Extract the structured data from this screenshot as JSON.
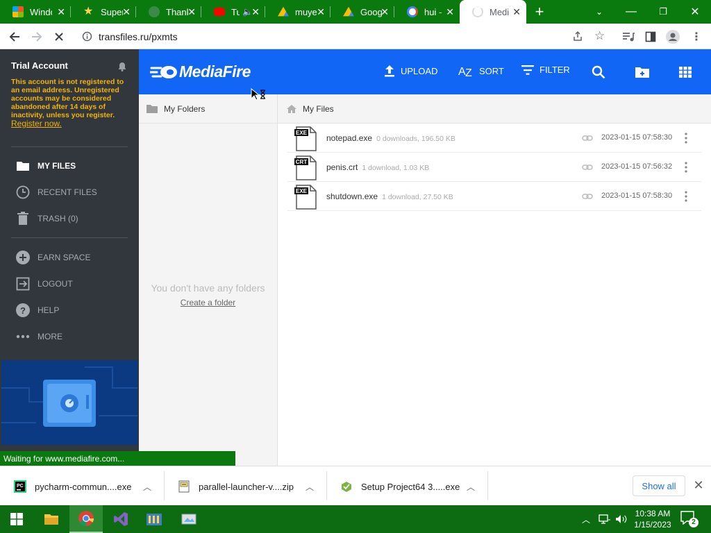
{
  "browser": {
    "tabs": [
      {
        "title": "Windows",
        "icon": "windows-logo-icon",
        "favicon_color": "#f35325"
      },
      {
        "title": "Super",
        "icon": "star-icon",
        "favicon_color": "#1a237e"
      },
      {
        "title": "Thank",
        "icon": "globe-icon",
        "favicon_color": "#607d8b"
      },
      {
        "title": "Tu",
        "icon": "youtube-icon",
        "favicon_color": "#ff0000"
      },
      {
        "title": "muye",
        "icon": "google-drive-icon",
        "favicon_color": "#fbbc04"
      },
      {
        "title": "Goog",
        "icon": "google-drive-icon",
        "favicon_color": "#34a853"
      },
      {
        "title": "hui -",
        "icon": "google-icon",
        "favicon_color": "#4285f4"
      },
      {
        "title": "Medi",
        "icon": "loading-spinner-icon",
        "favicon_color": "#d0d7de"
      }
    ],
    "url": "transfiles.ru/pxmts",
    "status_text": "Waiting for www.mediafire.com..."
  },
  "sidebar": {
    "account_title": "Trial Account",
    "notice": "This account is not registered to an email address. Unregistered accounts may be considered abandoned after 14 days of inactivity, unless you register.",
    "register_link": "Register now.",
    "nav": [
      {
        "label": "MY FILES",
        "icon": "folder-icon"
      },
      {
        "label": "RECENT FILES",
        "icon": "clock-icon"
      },
      {
        "label": "TRASH (0)",
        "icon": "trash-icon"
      },
      {
        "label": "EARN SPACE",
        "icon": "plus-circle-icon"
      },
      {
        "label": "LOGOUT",
        "icon": "logout-icon"
      },
      {
        "label": "HELP",
        "icon": "help-icon"
      },
      {
        "label": "MORE",
        "icon": "more-dots-icon"
      }
    ]
  },
  "header": {
    "logo": "MediaFire",
    "actions": [
      {
        "label": "UPLOAD",
        "icon": "upload-icon"
      },
      {
        "label": "SORT",
        "icon": "sort-az-icon"
      },
      {
        "label": "FILTER",
        "icon": "filter-icon"
      }
    ]
  },
  "folders": {
    "title": "My Folders",
    "empty_text": "You don't have any folders",
    "create_link": "Create a folder"
  },
  "files": {
    "breadcrumb": "My Files",
    "items": [
      {
        "type": "EXE",
        "name": "notepad.exe",
        "meta": "0 downloads, 196.50 KB",
        "date": "2023-01-15 07:58:30"
      },
      {
        "type": "CRT",
        "name": "penis.crt",
        "meta": "1 download, 1.03 KB",
        "date": "2023-01-15 07:56:32"
      },
      {
        "type": "EXE",
        "name": "shutdown.exe",
        "meta": "1 download, 27.50 KB",
        "date": "2023-01-15 07:58:30"
      }
    ]
  },
  "downloads": {
    "items": [
      {
        "name": "pycharm-commun....exe",
        "icon": "pycharm-icon"
      },
      {
        "name": "parallel-launcher-v....zip",
        "icon": "zip-icon"
      },
      {
        "name": "Setup Project64 3.....exe",
        "icon": "installer-icon"
      }
    ],
    "show_all": "Show all"
  },
  "taskbar": {
    "time": "10:38 AM",
    "date": "1/15/2023",
    "notifications": "2"
  }
}
